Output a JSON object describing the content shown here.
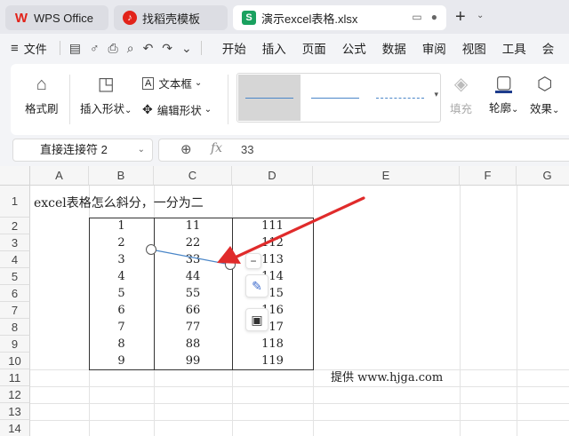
{
  "tabs": {
    "wps": {
      "label": "WPS Office",
      "icon": "wps-logo-icon"
    },
    "template": {
      "label": "找稻壳模板",
      "icon": "daoke-logo-icon"
    },
    "document": {
      "label": "演示excel表格.xlsx",
      "icon_letter": "S"
    }
  },
  "menubar": {
    "file_label": "文件",
    "items": [
      "开始",
      "插入",
      "页面",
      "公式",
      "数据",
      "审阅",
      "视图",
      "工具",
      "会"
    ]
  },
  "ribbon": {
    "format_painter": "格式刷",
    "insert_shape": "插入形状",
    "text_box": "文本框",
    "edit_shape": "编辑形状",
    "fill": "填充",
    "outline": "轮廓",
    "effects": "效果"
  },
  "formula_bar": {
    "name_box": "直接连接符 2",
    "fx_symbol": "fx",
    "value": "33"
  },
  "sheet": {
    "columns": [
      "A",
      "B",
      "C",
      "D",
      "E",
      "F",
      "G"
    ],
    "rows": [
      "1",
      "2",
      "3",
      "4",
      "5",
      "6",
      "7",
      "8",
      "9",
      "10",
      "11",
      "12",
      "13",
      "14"
    ],
    "title": "excel表格怎么斜分，一分为二",
    "data": [
      [
        "1",
        "11",
        "111"
      ],
      [
        "2",
        "22",
        "112"
      ],
      [
        "3",
        "33",
        "113"
      ],
      [
        "4",
        "44",
        "114"
      ],
      [
        "5",
        "55",
        "115"
      ],
      [
        "6",
        "66",
        "116"
      ],
      [
        "7",
        "77",
        "117"
      ],
      [
        "8",
        "88",
        "118"
      ],
      [
        "9",
        "99",
        "119"
      ]
    ],
    "credit": "提供 www.hjga.com"
  },
  "colors": {
    "accent": "#3d6bcd",
    "arrow": "#e02b2b",
    "connector": "#4a86c8",
    "sheet_tab_green": "#1aa15f"
  }
}
